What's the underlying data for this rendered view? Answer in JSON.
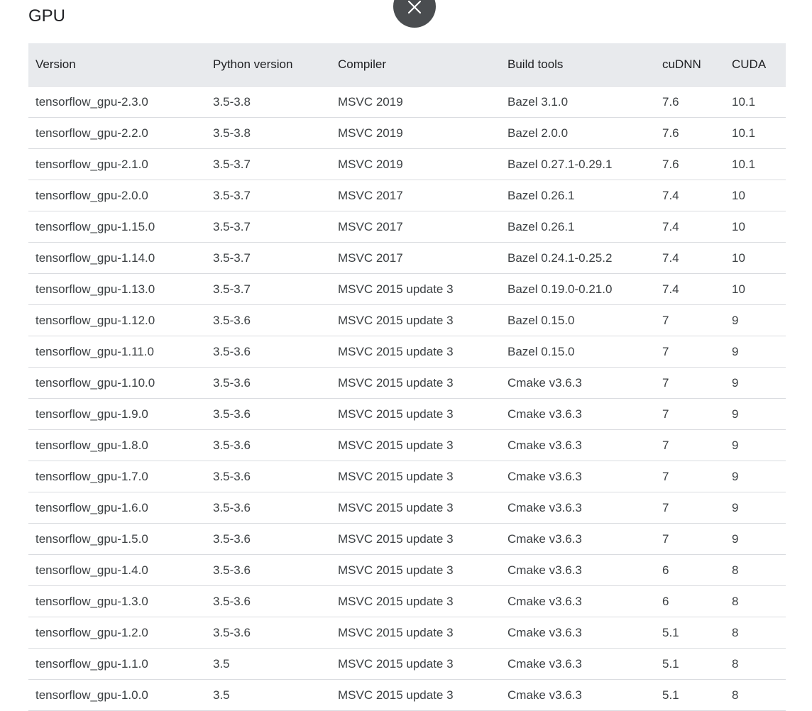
{
  "page": {
    "title": "GPU"
  },
  "close_icon": "close-icon",
  "colors": {
    "header_bg": "#e8eaed",
    "close_button_bg": "#4a4d50",
    "row_border": "#dadce0",
    "text": "#3c4043"
  },
  "table": {
    "headers": [
      "Version",
      "Python version",
      "Compiler",
      "Build tools",
      "cuDNN",
      "CUDA"
    ],
    "rows": [
      [
        "tensorflow_gpu-2.3.0",
        "3.5-3.8",
        "MSVC 2019",
        "Bazel 3.1.0",
        "7.6",
        "10.1"
      ],
      [
        "tensorflow_gpu-2.2.0",
        "3.5-3.8",
        "MSVC 2019",
        "Bazel 2.0.0",
        "7.6",
        "10.1"
      ],
      [
        "tensorflow_gpu-2.1.0",
        "3.5-3.7",
        "MSVC 2019",
        "Bazel 0.27.1-0.29.1",
        "7.6",
        "10.1"
      ],
      [
        "tensorflow_gpu-2.0.0",
        "3.5-3.7",
        "MSVC 2017",
        "Bazel 0.26.1",
        "7.4",
        "10"
      ],
      [
        "tensorflow_gpu-1.15.0",
        "3.5-3.7",
        "MSVC 2017",
        "Bazel 0.26.1",
        "7.4",
        "10"
      ],
      [
        "tensorflow_gpu-1.14.0",
        "3.5-3.7",
        "MSVC 2017",
        "Bazel 0.24.1-0.25.2",
        "7.4",
        "10"
      ],
      [
        "tensorflow_gpu-1.13.0",
        "3.5-3.7",
        "MSVC 2015 update 3",
        "Bazel 0.19.0-0.21.0",
        "7.4",
        "10"
      ],
      [
        "tensorflow_gpu-1.12.0",
        "3.5-3.6",
        "MSVC 2015 update 3",
        "Bazel 0.15.0",
        "7",
        "9"
      ],
      [
        "tensorflow_gpu-1.11.0",
        "3.5-3.6",
        "MSVC 2015 update 3",
        "Bazel 0.15.0",
        "7",
        "9"
      ],
      [
        "tensorflow_gpu-1.10.0",
        "3.5-3.6",
        "MSVC 2015 update 3",
        "Cmake v3.6.3",
        "7",
        "9"
      ],
      [
        "tensorflow_gpu-1.9.0",
        "3.5-3.6",
        "MSVC 2015 update 3",
        "Cmake v3.6.3",
        "7",
        "9"
      ],
      [
        "tensorflow_gpu-1.8.0",
        "3.5-3.6",
        "MSVC 2015 update 3",
        "Cmake v3.6.3",
        "7",
        "9"
      ],
      [
        "tensorflow_gpu-1.7.0",
        "3.5-3.6",
        "MSVC 2015 update 3",
        "Cmake v3.6.3",
        "7",
        "9"
      ],
      [
        "tensorflow_gpu-1.6.0",
        "3.5-3.6",
        "MSVC 2015 update 3",
        "Cmake v3.6.3",
        "7",
        "9"
      ],
      [
        "tensorflow_gpu-1.5.0",
        "3.5-3.6",
        "MSVC 2015 update 3",
        "Cmake v3.6.3",
        "7",
        "9"
      ],
      [
        "tensorflow_gpu-1.4.0",
        "3.5-3.6",
        "MSVC 2015 update 3",
        "Cmake v3.6.3",
        "6",
        "8"
      ],
      [
        "tensorflow_gpu-1.3.0",
        "3.5-3.6",
        "MSVC 2015 update 3",
        "Cmake v3.6.3",
        "6",
        "8"
      ],
      [
        "tensorflow_gpu-1.2.0",
        "3.5-3.6",
        "MSVC 2015 update 3",
        "Cmake v3.6.3",
        "5.1",
        "8"
      ],
      [
        "tensorflow_gpu-1.1.0",
        "3.5",
        "MSVC 2015 update 3",
        "Cmake v3.6.3",
        "5.1",
        "8"
      ],
      [
        "tensorflow_gpu-1.0.0",
        "3.5",
        "MSVC 2015 update 3",
        "Cmake v3.6.3",
        "5.1",
        "8"
      ]
    ]
  }
}
